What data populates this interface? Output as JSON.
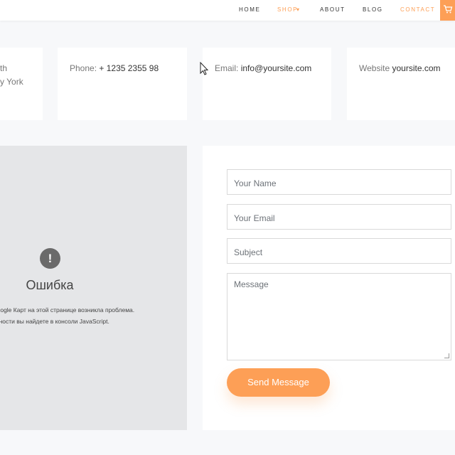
{
  "nav": {
    "items": [
      {
        "label": "HOME",
        "active": false
      },
      {
        "label": "SHOP",
        "active": true
      },
      {
        "label": "ABOUT",
        "active": false
      },
      {
        "label": "BLOG",
        "active": false
      },
      {
        "label": "CONTACT",
        "active": true
      }
    ],
    "shop_caret": "▾",
    "cart_icon": "cart-icon"
  },
  "info": {
    "address_line1": "th",
    "address_line2": "y York",
    "phone_label": "Phone:",
    "phone_value": "+ 1235 2355 98",
    "email_label": "Email:",
    "email_value": "info@yoursite.com",
    "website_label": "Website",
    "website_value": "yoursite.com"
  },
  "map": {
    "error_icon": "!",
    "error_title": "Ошибка",
    "error_line1": "Google Карт на этой странице возникла проблема.",
    "error_line2": "обности вы найдете в консоли JavaScript."
  },
  "form": {
    "name_placeholder": "Your Name",
    "email_placeholder": "Your Email",
    "subject_placeholder": "Subject",
    "message_placeholder": "Message",
    "send_label": "Send Message"
  },
  "colors": {
    "accent": "#fd9f56",
    "background": "#f7f8fa",
    "map_bg": "#e5e6e8"
  }
}
